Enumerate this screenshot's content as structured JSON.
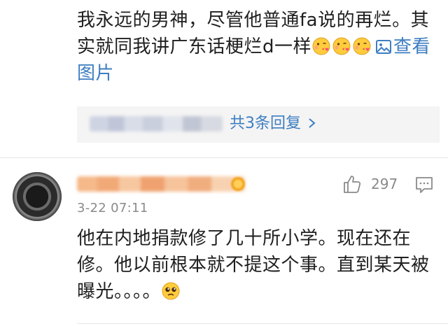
{
  "comment1": {
    "text": "我永远的男神，尽管他普通fa说的再烂。其实就同我讲广东话梗烂d一样",
    "emojis": [
      "kiss-emoji",
      "kiss-emoji",
      "kiss-emoji"
    ],
    "view_image_label": "查看图片",
    "replies_label": "共3条回复"
  },
  "comment2": {
    "timestamp": "3-22 07:11",
    "like_count": "297",
    "text": "他在内地捐款修了几十所小学。现在还在修。他以前根本就不提这个事。直到某天被曝光。。。。",
    "emoji": "pleading-emoji"
  },
  "colors": {
    "link": "#3d7ec2",
    "text": "#1f1f1f",
    "meta": "#8a8a8a",
    "reply_bg": "#f4f4f4"
  }
}
